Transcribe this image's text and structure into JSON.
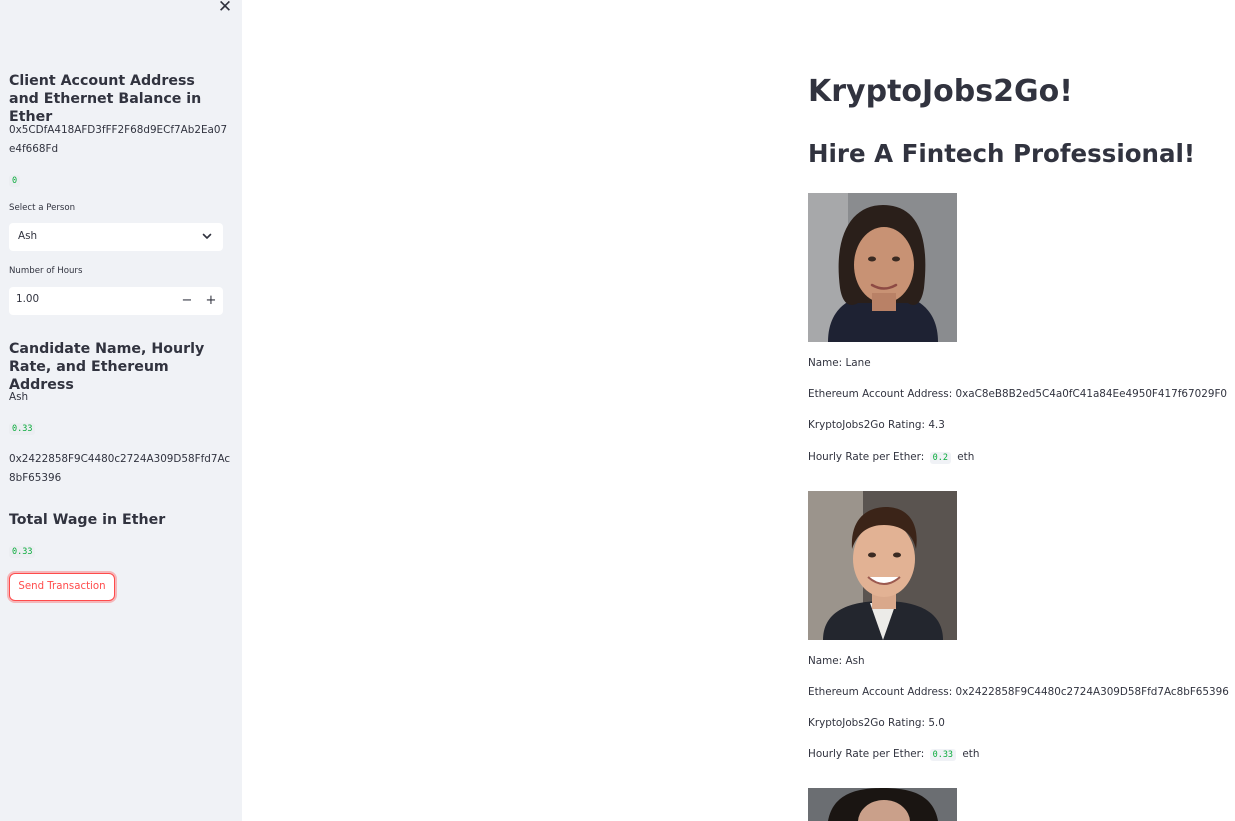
{
  "sidebar": {
    "close_icon": "close-icon",
    "client_heading": "Client Account Address and Ethernet Balance in Ether",
    "client_address": "0x5CDfA418AFD3fFF2F68d9ECf7Ab2Ea07e4f668Fd",
    "client_balance": "0",
    "select_person": {
      "label": "Select a Person",
      "value": "Ash",
      "icon": "chevron-down-icon"
    },
    "hours": {
      "label": "Number of Hours",
      "value": "1.00",
      "minus": "−",
      "plus": "+"
    },
    "candidate_heading": "Candidate Name, Hourly Rate, and Ethereum Address",
    "candidate_name": "Ash",
    "candidate_rate": "0.33",
    "candidate_address": "0x2422858F9C4480c2724A309D58Ffd7Ac8bF65396",
    "wage_heading": "Total Wage in Ether",
    "wage_value": "0.33",
    "send_button": "Send Transaction",
    "accent_color": "#ff4b4b",
    "code_color": "#09ab3b"
  },
  "main": {
    "title": "KryptoJobs2Go!",
    "subtitle": "Hire A Fintech Professional!",
    "candidates": [
      {
        "name_line": "Name: Lane",
        "address_line": "Ethereum Account Address: 0xaC8eB8B2ed5C4a0fC41a84Ee4950F417f67029F0",
        "rating_line": "KryptoJobs2Go Rating: 4.3",
        "rate_prefix": "Hourly Rate per Ether:",
        "rate_value": "0.2",
        "rate_unit": "eth"
      },
      {
        "name_line": "Name: Ash",
        "address_line": "Ethereum Account Address: 0x2422858F9C4480c2724A309D58Ffd7Ac8bF65396",
        "rating_line": "KryptoJobs2Go Rating: 5.0",
        "rate_prefix": "Hourly Rate per Ether:",
        "rate_value": "0.33",
        "rate_unit": "eth"
      }
    ]
  }
}
